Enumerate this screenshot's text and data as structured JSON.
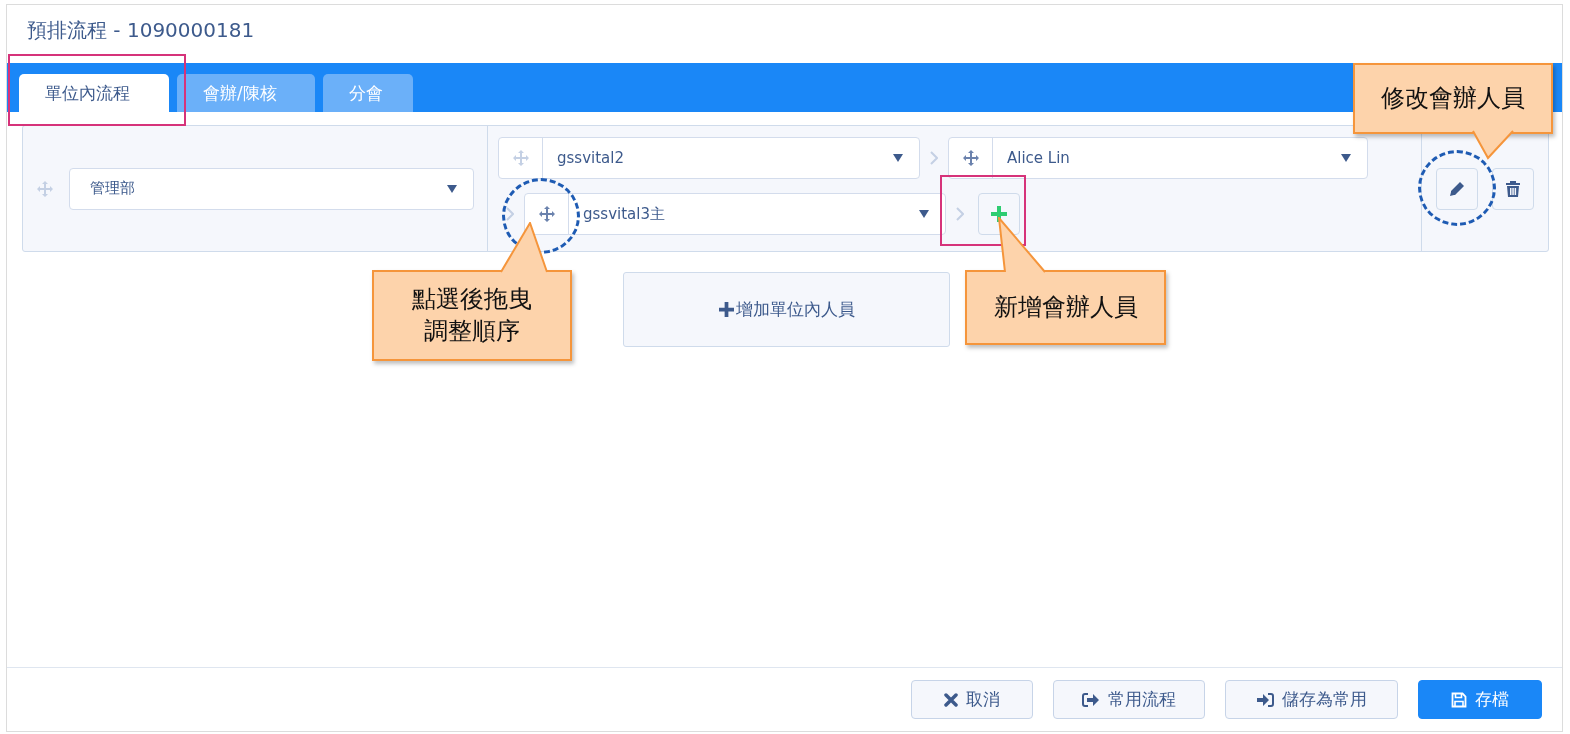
{
  "title": "預排流程 - 1090000181",
  "tabs": [
    {
      "label": "單位內流程",
      "selected": true
    },
    {
      "label": "會辦/陳核",
      "selected": false
    },
    {
      "label": "分會",
      "selected": false
    }
  ],
  "flow": {
    "department": "管理部",
    "approver_rows": [
      {
        "members": [
          "gssvital2",
          "Alice Lin"
        ],
        "add_button": false
      },
      {
        "members": [
          "gssvital3主"
        ],
        "add_button": true
      }
    ]
  },
  "add_member_button": "增加單位內人員",
  "footer_buttons": [
    {
      "label": "取消",
      "kind": "cancel"
    },
    {
      "label": "常用流程",
      "kind": "load"
    },
    {
      "label": "儲存為常用",
      "kind": "save-common"
    },
    {
      "label": "存檔",
      "kind": "save"
    }
  ],
  "callouts": [
    {
      "lines": [
        "修改會辦人員"
      ]
    },
    {
      "lines": [
        "點選後拖曳",
        "調整順序"
      ]
    },
    {
      "lines": [
        "新增會辦人員"
      ]
    }
  ]
}
